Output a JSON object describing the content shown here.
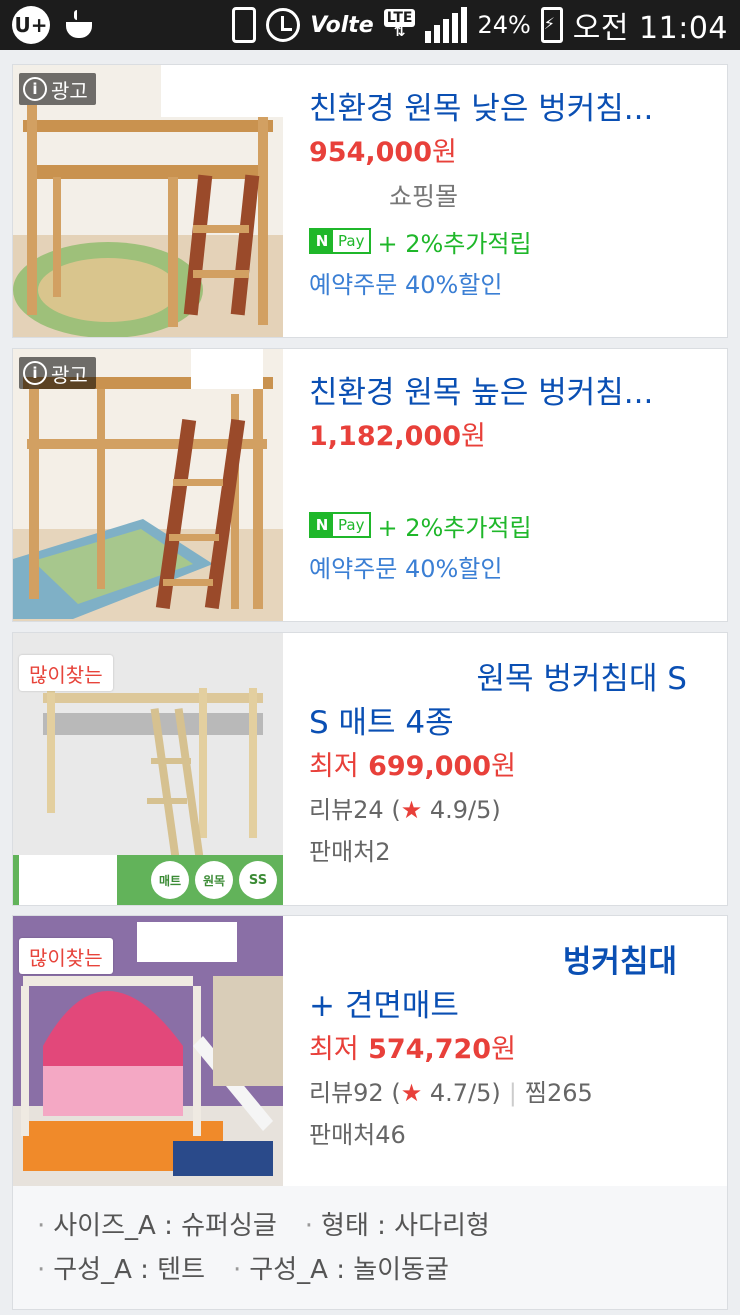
{
  "status_bar": {
    "carrier_logo": "U+",
    "icons": [
      "uplus-icon",
      "coffee-icon",
      "vibrate-icon",
      "alarm-icon",
      "volte-icon",
      "lte-icon",
      "signal-icon",
      "battery-charging-icon"
    ],
    "volte": "Volte",
    "lte": "LTE",
    "battery": "24%",
    "time": "오전 11:04"
  },
  "colors": {
    "title_blue": "#0a4fb3",
    "price_red": "#e8403a",
    "npay_green": "#1fb72a",
    "promo_blue": "#3b7fd4"
  },
  "products": [
    {
      "badge": "광고",
      "title": "친환경 원목 낮은 벙커침...",
      "price": "954,000",
      "unit": "원",
      "mall": "쇼핑몰",
      "npay_n": "N",
      "npay_pay": "Pay",
      "npay_reward": "+ 2%추가적립",
      "promo": "예약주문 40%할인"
    },
    {
      "badge": "광고",
      "title": "친환경 원목 높은 벙커침...",
      "price": "1,182,000",
      "unit": "원",
      "npay_n": "N",
      "npay_pay": "Pay",
      "npay_reward": "+ 2%추가적립",
      "promo": "예약주문 40%할인"
    },
    {
      "badge": "많이찾는",
      "title_line1": "원목 벙커침대 S",
      "title_line2": "S 매트 4종",
      "price_prefix": "최저",
      "price": "699,000",
      "unit": "원",
      "review_label": "리뷰24",
      "rating": "4.9",
      "rating_max": "/5",
      "sellers": "판매처2",
      "image_tags": [
        "매트",
        "원목",
        "SS"
      ]
    },
    {
      "badge": "많이찾는",
      "title_line1": "벙커침대",
      "title_line2": "+ 견면매트",
      "price_prefix": "최저",
      "price": "574,720",
      "unit": "원",
      "review_label": "리뷰92",
      "rating": "4.7",
      "rating_max": "/5",
      "wishlist": "찜265",
      "sellers": "판매처46",
      "attributes": [
        "사이즈_A : 슈퍼싱글",
        "형태 : 사다리형",
        "구성_A : 텐트",
        "구성_A : 놀이동굴"
      ]
    }
  ]
}
